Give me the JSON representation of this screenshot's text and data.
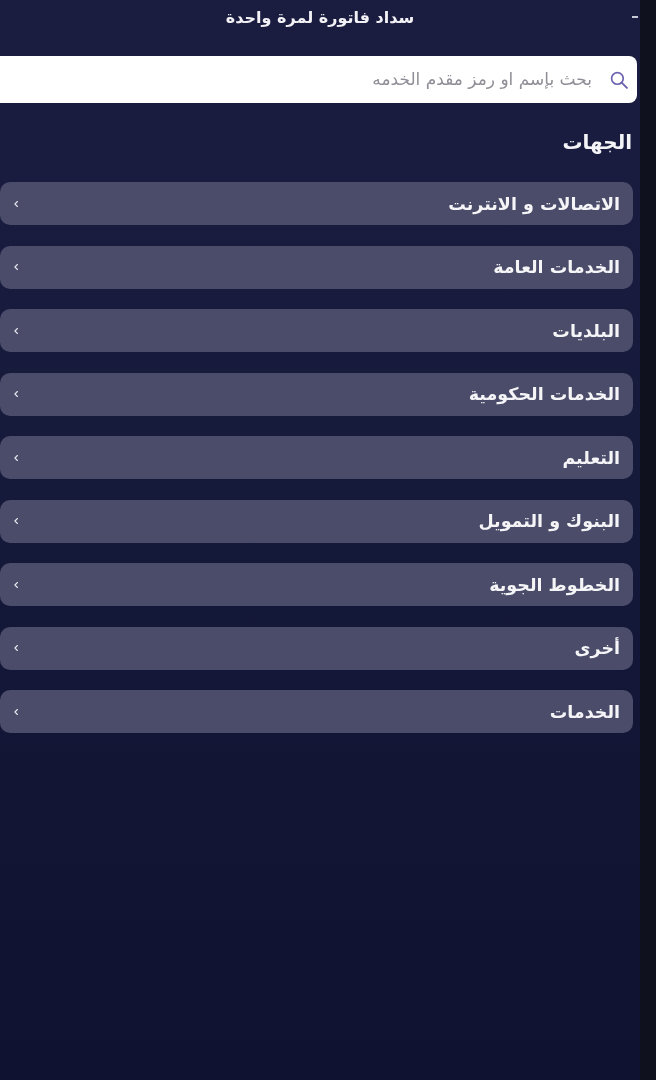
{
  "header": {
    "title": "سداد فاتورة لمرة واحدة"
  },
  "search": {
    "placeholder": "بحث بإسم او رمز مقدم الخدمه"
  },
  "section": {
    "title": "الجهات"
  },
  "categories": [
    {
      "label": "الاتصالات و الانترنت"
    },
    {
      "label": "الخدمات العامة"
    },
    {
      "label": "البلديات"
    },
    {
      "label": "الخدمات الحكومية"
    },
    {
      "label": "التعليم"
    },
    {
      "label": "البنوك و التمويل"
    },
    {
      "label": "الخطوط الجوية"
    },
    {
      "label": "أخرى"
    },
    {
      "label": "الخدمات"
    }
  ]
}
